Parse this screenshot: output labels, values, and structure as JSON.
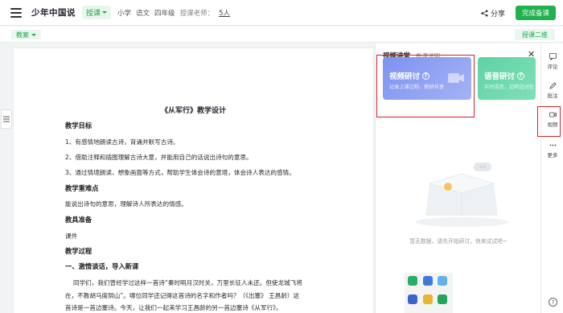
{
  "header": {
    "doc_title": "少年中国说",
    "mode": "授课",
    "grade": "小学",
    "subject": "语文",
    "level": "四年级",
    "author": "授课老师：",
    "collaborators": "5人",
    "share": "分享",
    "finish": "完成备课"
  },
  "toolbar": {
    "left_pill": "教案",
    "right_btn": "授课二维"
  },
  "document": {
    "title": "《从军行》教学设计",
    "sections": [
      {
        "label": "教学目标"
      },
      {
        "label": "教学重难点"
      },
      {
        "label": "教具准备"
      },
      {
        "label": "教学过程"
      }
    ],
    "goals": [
      "1、有感情地朗读古诗，背诵并默写古诗。",
      "2、借助注释和插图理解古诗大意，并能用自己的话说出诗句的意思。",
      "3、通过情境朗读、想象画面等方式，帮助学生体会诗的意境，体会诗人表达的感情。"
    ],
    "key_points": "能说出诗句的意思，理解诗人所表达的情感。",
    "tools": "课件",
    "step1": "一、激情谈话，导入新课",
    "intro1": "同学们，我们曾经学过这样一首诗“秦时明月汉时关，万里长征人未还。但使龙城飞将",
    "intro2": "在，不教胡马度阴山”。哪位同学还记得这首诗的名字和作者吗？（《出塞》 王昌龄）这",
    "intro3": "首诗是一首边塞诗。今天，让我们一起来学习王昌龄的另一首边塞诗《从军行》。"
  },
  "panel": {
    "tab_active": "视频讲堂",
    "tab_other": "备课说明",
    "card_video_title": "视频研讨",
    "card_video_sub": "记录上课过程，教研共享",
    "card_audio_title": "语音研讨",
    "card_audio_sub": "实时语音，边听边讨论",
    "empty_text": "暂无数据，请先开始研讨，快来试试吧~"
  },
  "rbar": {
    "items": [
      "评论",
      "批注",
      "视频",
      "更多"
    ]
  },
  "colors": {
    "accent": "#21b14f",
    "highlight": "#d4232b",
    "video_card": "#7d93f0",
    "audio_card": "#5fd2a4"
  }
}
